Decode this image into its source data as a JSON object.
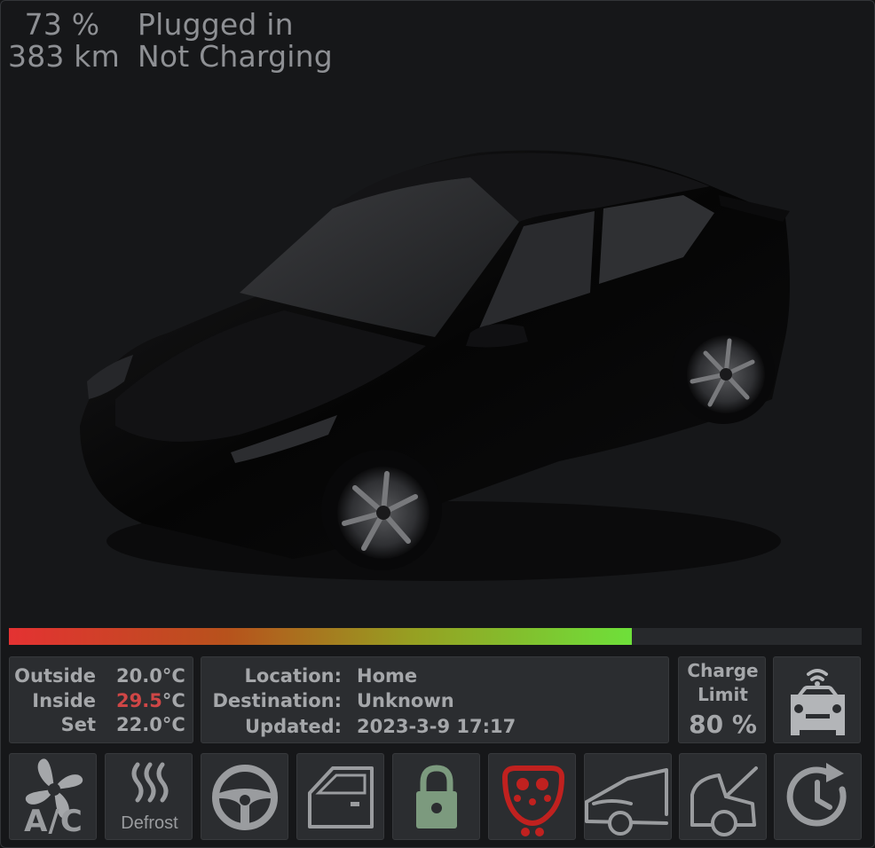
{
  "status": {
    "battery_percent": "73 %",
    "range": "383 km",
    "plug_state": "Plugged in",
    "charge_state": "Not Charging",
    "battery_level": 0.73
  },
  "climate": {
    "outside_label": "Outside",
    "outside_value": "20.0°C",
    "inside_label": "Inside",
    "inside_value": "29.5",
    "inside_unit": "°C",
    "set_label": "Set",
    "set_value": "22.0°C"
  },
  "location": {
    "location_label": "Location:",
    "location_value": "Home",
    "destination_label": "Destination:",
    "destination_value": "Unknown",
    "updated_label": "Updated:",
    "updated_value": "2023-3-9 17:17"
  },
  "charge_limit": {
    "title_line1": "Charge",
    "title_line2": "Limit",
    "value": "80 %"
  },
  "buttons": {
    "defrost_label": "Defrost",
    "ac_label": "A/C"
  },
  "colors": {
    "panel": "#2b2d30",
    "text": "#a5a7aa",
    "hot": "#cf4646",
    "charge_port_red": "#c0211f",
    "lock_green": "#7c9a7e"
  }
}
